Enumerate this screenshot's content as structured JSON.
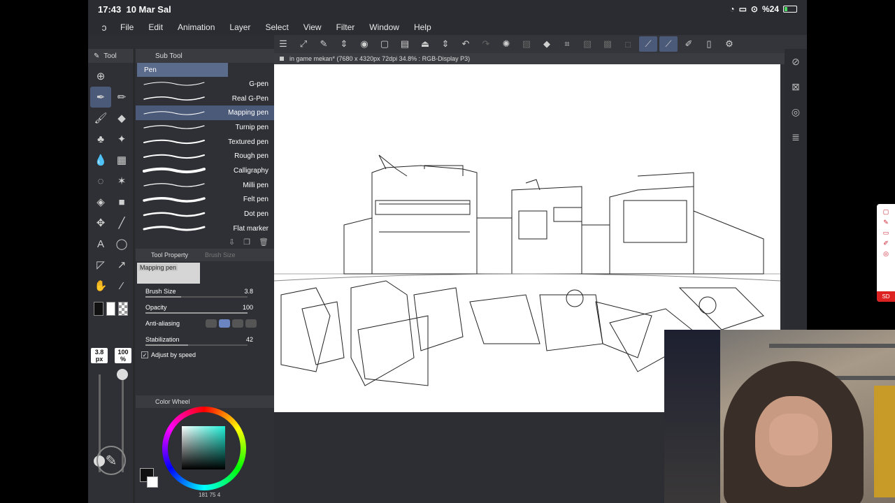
{
  "status": {
    "time": "17:43",
    "date": "10 Mar Sal",
    "battery": "%24"
  },
  "menu": [
    "File",
    "Edit",
    "Animation",
    "Layer",
    "Select",
    "View",
    "Filter",
    "Window",
    "Help"
  ],
  "tool_panel": {
    "tab_tool": "Tool",
    "tab_subtool": "Sub Tool",
    "group": "Pen"
  },
  "brushes": [
    "G-pen",
    "Real G-Pen",
    "Mapping pen",
    "Turnip pen",
    "Textured pen",
    "Rough pen",
    "Calligraphy",
    "Milli pen",
    "Felt pen",
    "Dot pen",
    "Flat marker"
  ],
  "selected_brush_index": 2,
  "tool_property": {
    "tab": "Tool Property",
    "tab_inactive": "Brush Size",
    "preview_label": "Mapping pen",
    "brush_size_label": "Brush Size",
    "brush_size": "3.8",
    "opacity_label": "Opacity",
    "opacity": "100",
    "antialias_label": "Anti-aliasing",
    "stabilization_label": "Stabilization",
    "stabilization": "42",
    "adjust_label": "Adjust by speed"
  },
  "quick_size": {
    "size": "3.8 px",
    "opacity": "100 %"
  },
  "color_wheel": {
    "label": "Color Wheel",
    "readout": "181  75  4"
  },
  "document": {
    "title": "in game mekan* (7680 x 4320px 72dpi 34.8% : RGB-Display P3)"
  },
  "colors": {
    "accent": "#4a5a78",
    "panel": "#2f3035",
    "canvas": "#ffffff"
  }
}
